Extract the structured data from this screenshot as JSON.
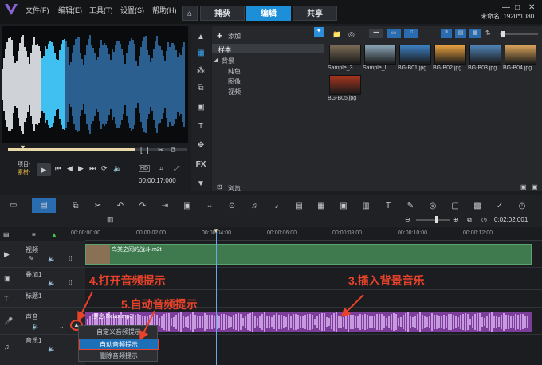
{
  "menu": {
    "file": "文件(F)",
    "edit": "编辑(E)",
    "tools": "工具(T)",
    "settings": "设置(S)",
    "help": "帮助(H)"
  },
  "tabs": {
    "capture": "捕获",
    "edit": "编辑",
    "share": "共享"
  },
  "project": {
    "name": "未命名, 1920*1080"
  },
  "player": {
    "project_label": "项目-",
    "clip_label": "素材-",
    "timecode": "00:00:17:000"
  },
  "library": {
    "add_label": "添加",
    "tree": [
      "样本",
      "背景",
      "纯色",
      "图像",
      "视频"
    ],
    "browse_label": "浏览",
    "thumbnails": [
      {
        "caption": "Sample_3...",
        "color": "#7b6a55"
      },
      {
        "caption": "Sample_L...",
        "color": "#8aa4b5"
      },
      {
        "caption": "BG-B01.jpg",
        "color": "#3d7fc1"
      },
      {
        "caption": "BG-B02.jpg",
        "color": "#e8a040"
      },
      {
        "caption": "BG-B03.jpg",
        "color": "#4f82b5"
      },
      {
        "caption": "BG-B04.jpg",
        "color": "#d8a35a"
      },
      {
        "caption": "BG-B05.jpg",
        "color": "#a8351f"
      }
    ]
  },
  "timeline": {
    "ruler": [
      "00:00:00:00",
      "00:00:02:00",
      "00:00:04:00",
      "00:00:06:00",
      "00:00:08:00",
      "00:00:10:00",
      "00:00:12:00"
    ],
    "tracks": [
      "视频",
      "叠加1",
      "标题1",
      "声音",
      "音乐1"
    ],
    "video_clip": "鸟类之间的战斗.m2t",
    "audio_clip": "罗念 Relax.mp3",
    "timecode_right": "0:02:02:001"
  },
  "context_menu": [
    "自定义音频提示",
    "自动音频提示",
    "删除音频提示"
  ],
  "annotations": {
    "a4": "4.打开音频提示",
    "a3": "3.插入背景音乐",
    "a5": "5.自动音频提示"
  },
  "colors": {
    "accent": "#1d8fd8",
    "annotation": "#e8432a",
    "video_track": "#3e7a4e",
    "audio_track": "#7c3e9a"
  }
}
